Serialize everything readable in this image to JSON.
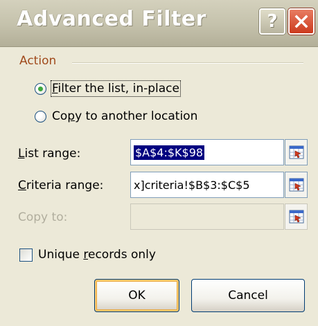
{
  "window": {
    "title": "Advanced Filter",
    "help_label": "?"
  },
  "action_group": {
    "label": "Action",
    "options": [
      {
        "label_mnemonic": "F",
        "label_rest": "ilter the list, in-place",
        "checked": true
      },
      {
        "label_prefix": "Co",
        "label_mnemonic": "p",
        "label_rest": "y to another location",
        "checked": false
      }
    ]
  },
  "fields": {
    "list_range": {
      "label_mnemonic": "L",
      "label_rest": "ist range:",
      "value": "$A$4:$K$98",
      "selected": true
    },
    "criteria_range": {
      "label_mnemonic": "C",
      "label_rest": "riteria range:",
      "value": "x]criteria!$B$3:$C$5"
    },
    "copy_to": {
      "label": "Copy to:",
      "value": "",
      "disabled": true
    }
  },
  "unique_records": {
    "label_prefix": "Unique ",
    "label_mnemonic": "r",
    "label_rest": "ecords only",
    "checked": false
  },
  "buttons": {
    "ok": "OK",
    "cancel": "Cancel"
  },
  "colors": {
    "dialog_bg": "#ece9d8",
    "group_label": "#a04a1c",
    "selection": "#000080",
    "close_button": "#cc3a1e"
  },
  "icons": {
    "range_selector": "collapse-dialog-icon",
    "close": "close-icon",
    "help": "help-icon"
  }
}
